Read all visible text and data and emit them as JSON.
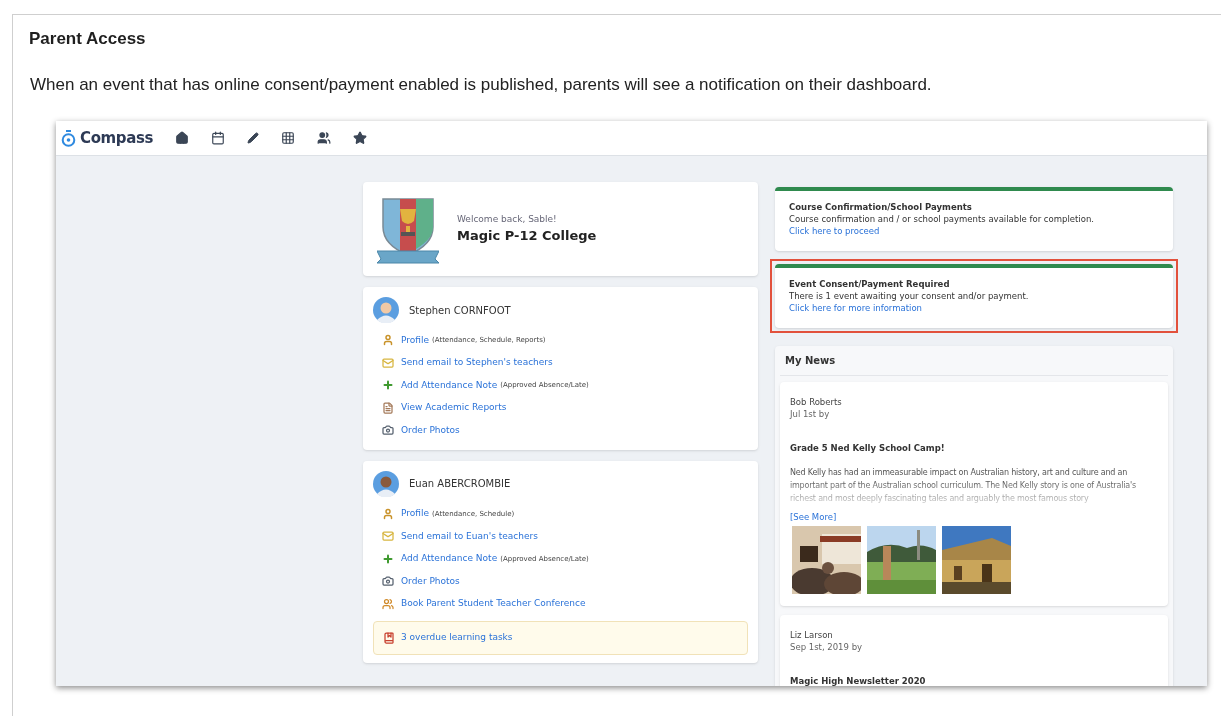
{
  "heading": "Parent Access",
  "intro": "When an event that has online consent/payment enabled is published, parents will see a notification on their dashboard.",
  "app": {
    "brand": "Compass",
    "welcome": {
      "greeting": "Welcome back, Sable!",
      "school": "Magic P-12 College"
    },
    "students": [
      {
        "name": "Stephen CORNFOOT",
        "links": [
          {
            "kind": "profile",
            "label": "Profile",
            "note": "(Attendance, Schedule, Reports)"
          },
          {
            "kind": "email",
            "label": "Send email to Stephen's teachers"
          },
          {
            "kind": "note",
            "label": "Add Attendance Note",
            "note": "(Approved Absence/Late)"
          },
          {
            "kind": "reports",
            "label": "View Academic Reports"
          },
          {
            "kind": "photos",
            "label": "Order Photos"
          }
        ]
      },
      {
        "name": "Euan ABERCROMBIE",
        "links": [
          {
            "kind": "profile",
            "label": "Profile",
            "note": "(Attendance, Schedule)"
          },
          {
            "kind": "email",
            "label": "Send email to Euan's teachers"
          },
          {
            "kind": "note",
            "label": "Add Attendance Note",
            "note": "(Approved Absence/Late)"
          },
          {
            "kind": "photos",
            "label": "Order Photos"
          },
          {
            "kind": "conference",
            "label": "Book Parent Student Teacher Conference"
          }
        ],
        "alert": "3 overdue learning tasks"
      }
    ],
    "notices": [
      {
        "title": "Course Confirmation/School Payments",
        "text": "Course confirmation and / or school payments available for completion.",
        "link": "Click here to proceed",
        "highlighted": false
      },
      {
        "title": "Event Consent/Payment Required",
        "text": "There is 1 event awaiting your consent and/or payment.",
        "link": "Click here for more information",
        "highlighted": true
      }
    ],
    "news": {
      "title": "My News",
      "posts": [
        {
          "author": "Bob Roberts",
          "date": "Jul 1st by",
          "title": "Grade 5 Ned Kelly School Camp!",
          "body": "Ned Kelly has had an immeasurable impact on Australian history, art and culture and an important part of the Australian school curriculum. The Ned Kelly story is one of Australia's richest and most deeply fascinating tales and arguably the most famous story",
          "more": "[See More]"
        },
        {
          "author": "Liz Larson",
          "date": "Sep 1st, 2019 by",
          "title": "Magic High Newsletter 2020"
        }
      ]
    }
  }
}
